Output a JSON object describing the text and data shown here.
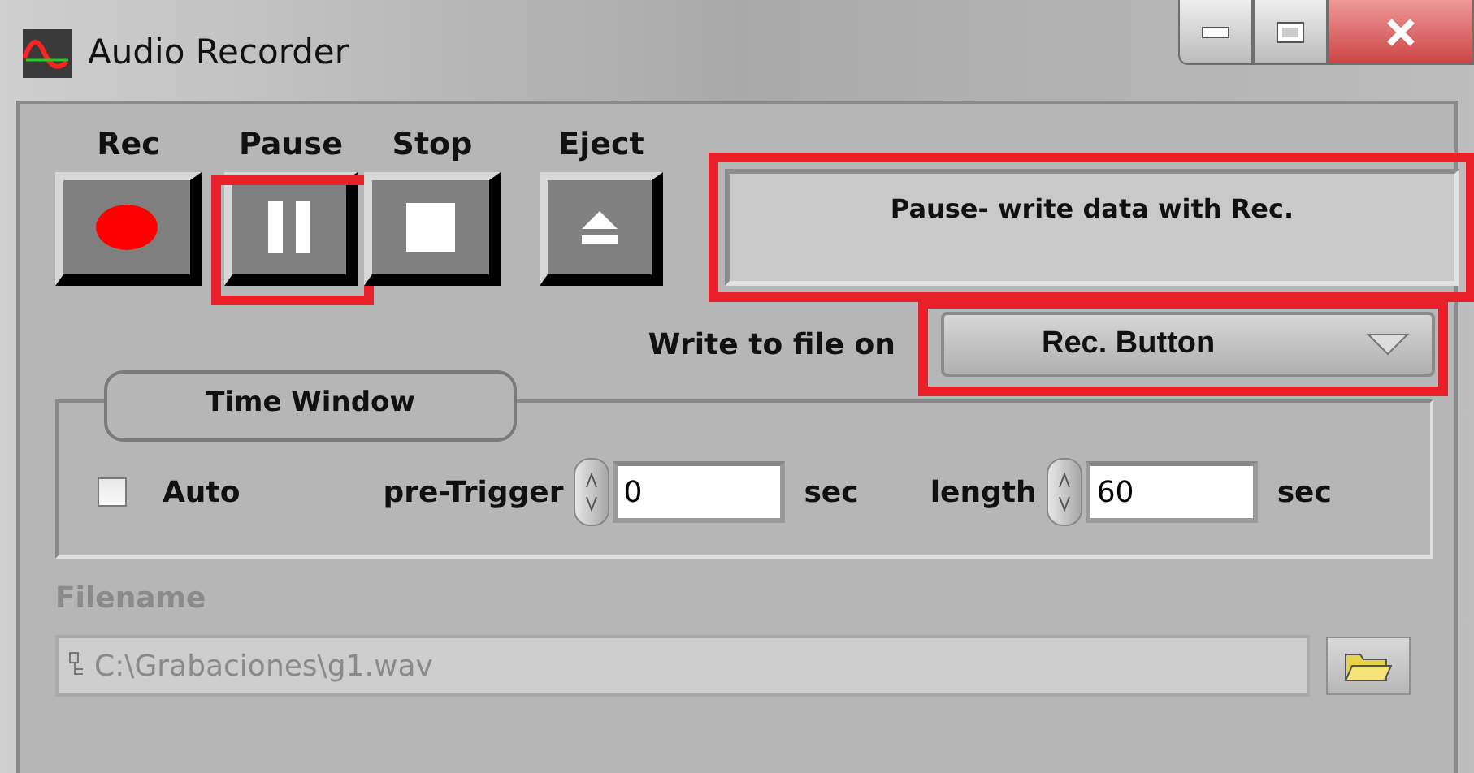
{
  "window": {
    "title": "Audio Recorder"
  },
  "transport": [
    {
      "label": "Rec",
      "kind": "record",
      "highlighted": false
    },
    {
      "label": "Pause",
      "kind": "pause",
      "highlighted": true
    },
    {
      "label": "Stop",
      "kind": "stop",
      "highlighted": false
    },
    {
      "label": "Eject",
      "kind": "eject",
      "highlighted": false
    }
  ],
  "status": {
    "text": "Pause- write data with Rec.",
    "highlighted": true
  },
  "write_mode": {
    "label": "Write to file on",
    "value": "Rec. Button",
    "highlighted": true
  },
  "time_window": {
    "title": "Time Window",
    "auto": {
      "label": "Auto",
      "checked": false
    },
    "pre_trigger": {
      "label": "pre-Trigger",
      "value": "0",
      "unit": "sec"
    },
    "length": {
      "label": "length",
      "value": "60",
      "unit": "sec"
    }
  },
  "filename": {
    "label": "Filename",
    "value": "C:\\Grabaciones\\g1.wav",
    "disabled": true
  }
}
